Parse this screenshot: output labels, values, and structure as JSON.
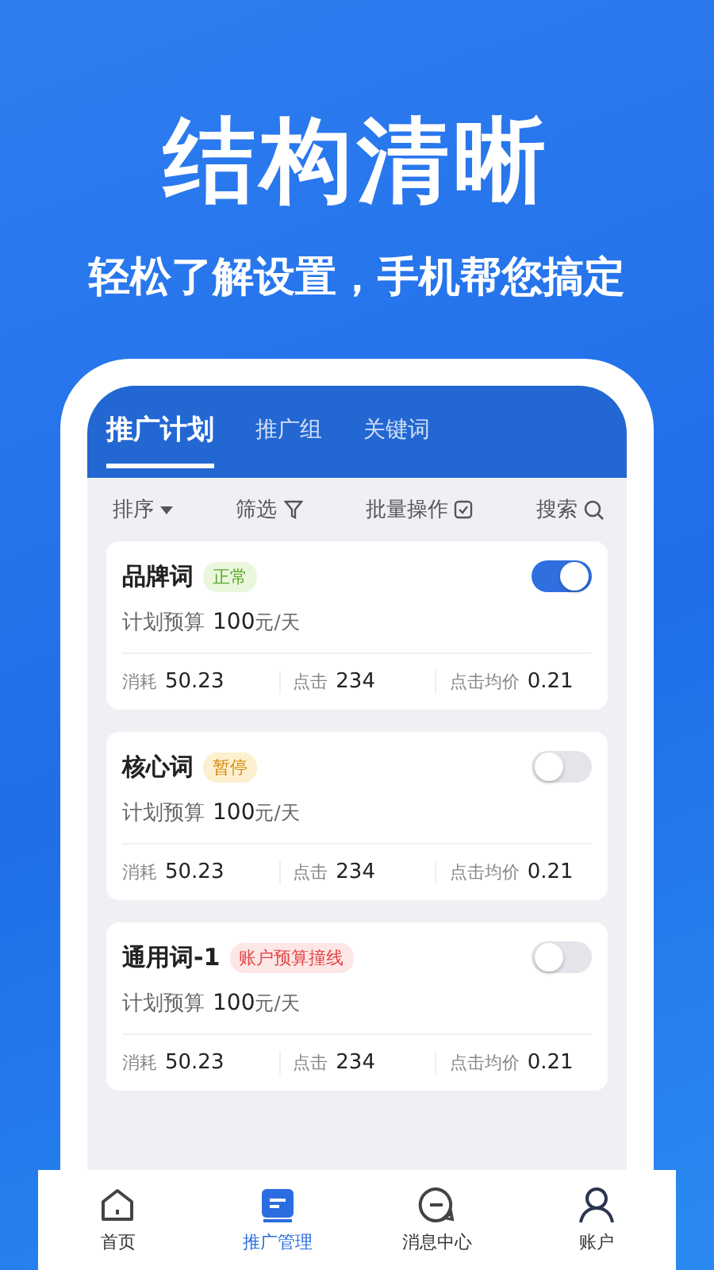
{
  "headline": "结构清晰",
  "subtitle": "轻松了解设置，手机帮您搞定",
  "tabs": [
    {
      "label": "推广计划",
      "selected": true
    },
    {
      "label": "推广组",
      "selected": false
    },
    {
      "label": "关键词",
      "selected": false
    }
  ],
  "toolbar": [
    {
      "label": "排序",
      "kind": "caret"
    },
    {
      "label": "筛选",
      "kind": "filter"
    },
    {
      "label": "批量操作",
      "kind": "batch"
    },
    {
      "label": "搜索",
      "kind": "search"
    }
  ],
  "plans": [
    {
      "name": "品牌词",
      "status": "正常",
      "kind": "normal",
      "on": true,
      "budget_label": "计划预算",
      "budget": "100",
      "budget_unit": "元/天",
      "stats": [
        {
          "label": "消耗",
          "value": "50.23"
        },
        {
          "label": "点击",
          "value": "234"
        },
        {
          "label": "点击均价",
          "value": "0.21"
        }
      ]
    },
    {
      "name": "核心词",
      "status": "暂停",
      "kind": "paused",
      "on": false,
      "budget_label": "计划预算",
      "budget": "100",
      "budget_unit": "元/天",
      "stats": [
        {
          "label": "消耗",
          "value": "50.23"
        },
        {
          "label": "点击",
          "value": "234"
        },
        {
          "label": "点击均价",
          "value": "0.21"
        }
      ]
    },
    {
      "name": "通用词-1",
      "status": "账户预算撞线",
      "kind": "alert",
      "on": false,
      "budget_label": "计划预算",
      "budget": "100",
      "budget_unit": "元/天",
      "stats": [
        {
          "label": "消耗",
          "value": "50.23"
        },
        {
          "label": "点击",
          "value": "234"
        },
        {
          "label": "点击均价",
          "value": "0.21"
        }
      ]
    }
  ],
  "nav": [
    {
      "label": "首页",
      "kind": "home",
      "selected": false
    },
    {
      "label": "推广管理",
      "kind": "manage",
      "selected": true
    },
    {
      "label": "消息中心",
      "kind": "message",
      "selected": false
    },
    {
      "label": "账户",
      "kind": "account",
      "selected": false
    }
  ]
}
